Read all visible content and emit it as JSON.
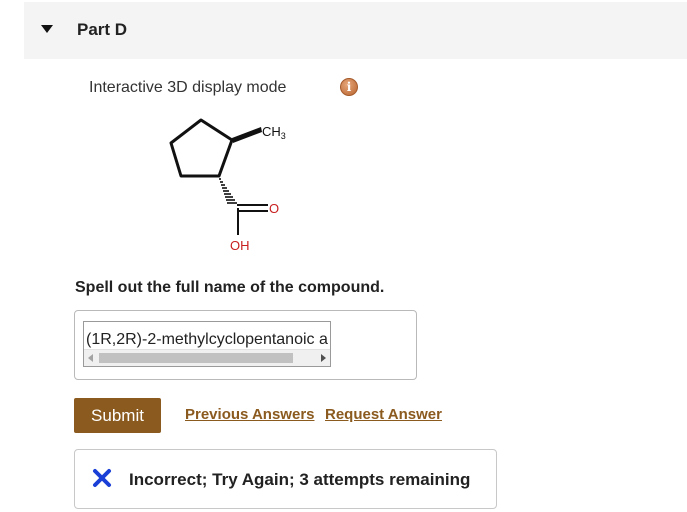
{
  "part": {
    "title": "Part D"
  },
  "display": {
    "mode_label": "Interactive 3D display mode",
    "info_icon": "info-icon"
  },
  "molecule": {
    "labels": {
      "methyl": "CH",
      "methyl_subscript": "3",
      "carbonyl_oxygen": "O",
      "hydroxyl": "OH"
    }
  },
  "question": {
    "text": "Spell out the full name of the compound."
  },
  "answer": {
    "value": "(1R,2R)-2-methylcyclopentanoic a"
  },
  "buttons": {
    "submit": "Submit",
    "previous_answers": "Previous Answers",
    "request_answer": "Request Answer"
  },
  "feedback": {
    "icon": "x-icon",
    "text": "Incorrect; Try Again; 3 attempts remaining",
    "color": "#1a3fd6"
  },
  "colors": {
    "accent": "#8b5a1e",
    "header_bg": "#f4f4f4",
    "info_icon": "#c47a45"
  }
}
